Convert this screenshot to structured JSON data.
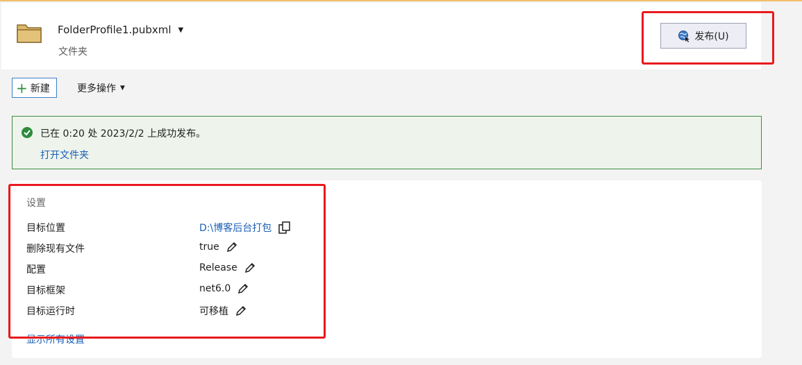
{
  "header": {
    "profile_name": "FolderProfile1.pubxml",
    "profile_type": "文件夹",
    "publish_label": "发布(U)"
  },
  "toolbar": {
    "new_label": "新建",
    "more_label": "更多操作"
  },
  "banner": {
    "message": "已在 0:20 处 2023/2/2 上成功发布。",
    "open_folder_label": "打开文件夹"
  },
  "settings": {
    "title": "设置",
    "rows": [
      {
        "label": "目标位置",
        "value": "D:\\博客后台打包",
        "icon": "copy-icon"
      },
      {
        "label": "删除现有文件",
        "value": "true",
        "icon": "edit-icon"
      },
      {
        "label": "配置",
        "value": "Release",
        "icon": "edit-icon"
      },
      {
        "label": "目标框架",
        "value": "net6.0",
        "icon": "edit-icon"
      },
      {
        "label": "目标运行时",
        "value": "可移植",
        "icon": "edit-icon"
      }
    ],
    "show_all_label": "显示所有设置"
  },
  "colors": {
    "highlight_box": "#e8191e",
    "success_border": "#3f8a3f",
    "link": "#1a5fb4",
    "top_accent": "#f2c069"
  }
}
